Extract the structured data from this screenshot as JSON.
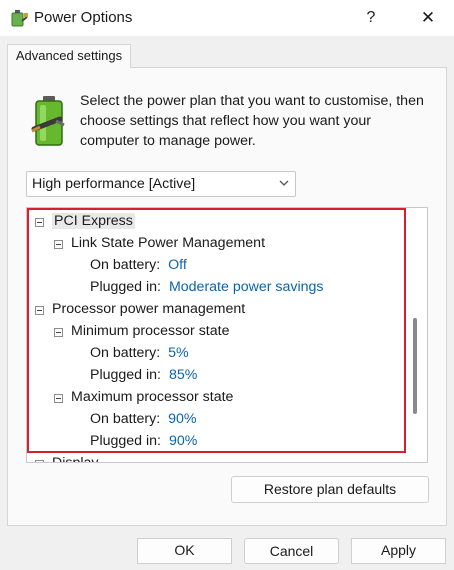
{
  "window": {
    "title": "Power Options",
    "help_label": "?",
    "close_label": "✕"
  },
  "tab": {
    "label": "Advanced settings"
  },
  "description": "Select the power plan that you want to customise, then choose settings that reflect how you want your computer to manage power.",
  "plan_select": {
    "value": "High performance [Active]"
  },
  "tree": {
    "pci_express": "PCI Express",
    "link_state": "Link State Power Management",
    "link_state_battery_label": "On battery:",
    "link_state_battery_value": "Off",
    "link_state_plugged_label": "Plugged in:",
    "link_state_plugged_value": "Moderate power savings",
    "processor": "Processor power management",
    "min_state": "Minimum processor state",
    "min_battery_label": "On battery:",
    "min_battery_value": "5%",
    "min_plugged_label": "Plugged in:",
    "min_plugged_value": "85%",
    "max_state": "Maximum processor state",
    "max_battery_label": "On battery:",
    "max_battery_value": "90%",
    "max_plugged_label": "Plugged in:",
    "max_plugged_value": "90%",
    "display": "Display"
  },
  "buttons": {
    "restore": "Restore plan defaults",
    "ok": "OK",
    "cancel": "Cancel",
    "apply": "Apply"
  },
  "colors": {
    "highlight": "#d6202f",
    "value_link": "#0a64ad"
  }
}
